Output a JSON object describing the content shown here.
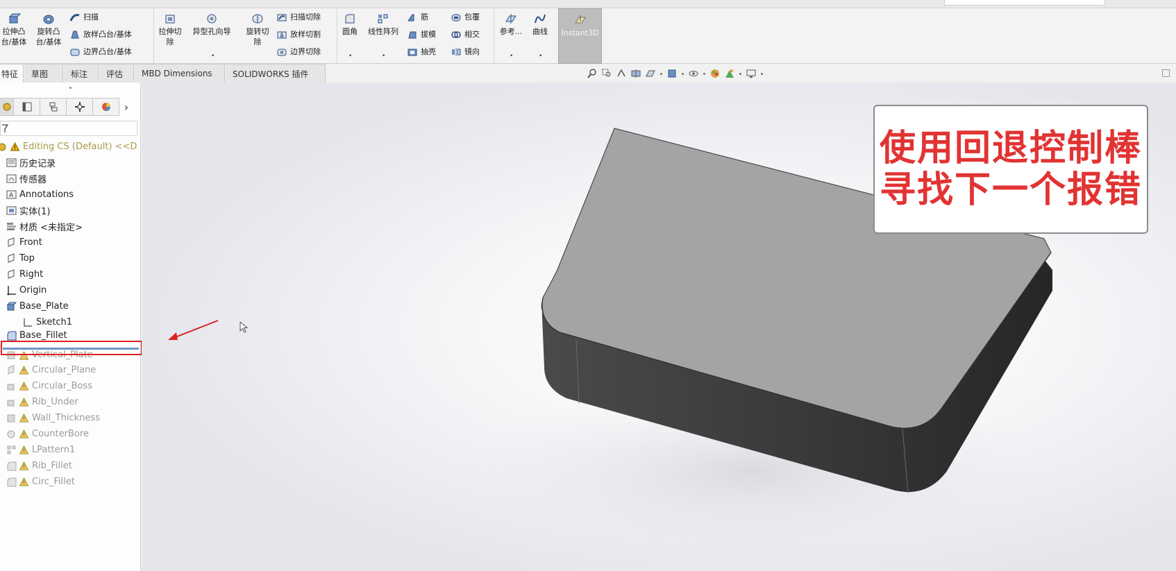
{
  "ribbon": {
    "group1": {
      "extrude_boss_line1": "拉伸凸",
      "extrude_boss_line2": "台/基体",
      "revolve_boss_line1": "旋转凸",
      "revolve_boss_line2": "台/基体",
      "sweep": "扫描",
      "loft_boss": "放样凸台/基体",
      "boundary_boss": "边界凸台/基体"
    },
    "group2": {
      "extrude_cut_line1": "拉伸切",
      "extrude_cut_line2": "除",
      "hole_wizard": "异型孔向导",
      "revolve_cut_line1": "旋转切",
      "revolve_cut_line2": "除",
      "swept_cut": "扫描切除",
      "lofted_cut": "放样切割",
      "boundary_cut": "边界切除"
    },
    "group3": {
      "fillet": "圆角",
      "linear_pattern": "线性阵列",
      "rib": "筋",
      "draft": "拔模",
      "shell": "抽壳",
      "wrap": "包覆",
      "intersect": "相交",
      "mirror": "镜向"
    },
    "group4": {
      "reference": "参考...",
      "curves": "曲线"
    },
    "instant3d": "Instant3D"
  },
  "tabs": [
    {
      "label": "特征"
    },
    {
      "label": "草图"
    },
    {
      "label": "标注"
    },
    {
      "label": "评估"
    },
    {
      "label": "MBD Dimensions"
    },
    {
      "label": "SOLIDWORKS 插件"
    }
  ],
  "feature_manager": {
    "grip": "•",
    "root": "Editing CS  (Default) <<D",
    "items": [
      {
        "label": "历史记录"
      },
      {
        "label": "传感器"
      },
      {
        "label": "Annotations"
      },
      {
        "label": "实体(1)"
      },
      {
        "label": "材质 <未指定>"
      },
      {
        "label": "Front"
      },
      {
        "label": "Top"
      },
      {
        "label": "Right"
      },
      {
        "label": "Origin"
      },
      {
        "label": "Base_Plate"
      },
      {
        "label": "Sketch1"
      },
      {
        "label": "Base_Fillet"
      },
      {
        "label": "Vertical_Plate"
      },
      {
        "label": "Circular_Plane"
      },
      {
        "label": "Circular_Boss"
      },
      {
        "label": "Rib_Under"
      },
      {
        "label": "Wall_Thickness"
      },
      {
        "label": "CounterBore"
      },
      {
        "label": "LPattern1"
      },
      {
        "label": "Rib_Fillet"
      },
      {
        "label": "Circ_Fillet"
      }
    ]
  },
  "callout": {
    "line1": "使用回退控制棒",
    "line2": "寻找下一个报错"
  },
  "colors": {
    "callout_text": "#e23333",
    "highlight_box": "#e02020",
    "rollback_bar": "#6f95c8",
    "warning": "#f0b400",
    "model_top": "#a6a6a6",
    "model_side": "#3a3a3a"
  }
}
